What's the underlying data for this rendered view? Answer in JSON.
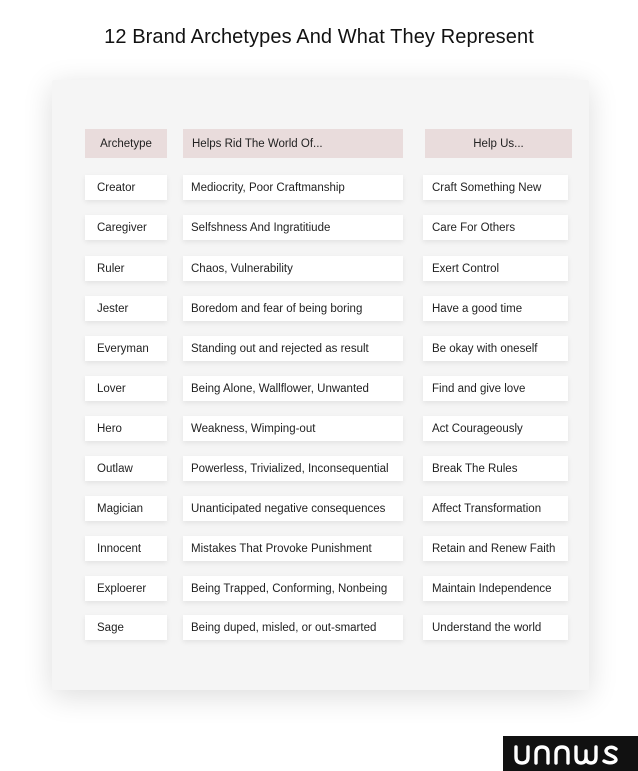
{
  "title": "12 Brand Archetypes And What They Represent",
  "headers": {
    "archetype": "Archetype",
    "rid": "Helps Rid The World Of...",
    "help": "Help Us..."
  },
  "rows": [
    {
      "archetype": "Creator",
      "rid": "Mediocrity, Poor Craftmanship",
      "help": "Craft Something New"
    },
    {
      "archetype": "Caregiver",
      "rid": "Selfshness And Ingratitiude",
      "help": "Care For Others"
    },
    {
      "archetype": "Ruler",
      "rid": "Chaos, Vulnerability",
      "help": "Exert Control"
    },
    {
      "archetype": "Jester",
      "rid": "Boredom and fear of being boring",
      "help": "Have a good time"
    },
    {
      "archetype": "Everyman",
      "rid": "Standing out and rejected as result",
      "help": "Be okay with oneself"
    },
    {
      "archetype": "Lover",
      "rid": "Being Alone, Wallflower, Unwanted",
      "help": "Find and give love"
    },
    {
      "archetype": "Hero",
      "rid": "Weakness, Wimping-out",
      "help": "Act Courageously"
    },
    {
      "archetype": "Outlaw",
      "rid": "Powerless, Trivialized, Inconsequential",
      "help": "Break The Rules"
    },
    {
      "archetype": "Magician",
      "rid": "Unanticipated negative consequences",
      "help": "Affect Transformation"
    },
    {
      "archetype": "Innocent",
      "rid": "Mistakes That Provoke Punishment",
      "help": "Retain and Renew Faith"
    },
    {
      "archetype": "Exploerer",
      "rid": "Being Trapped, Conforming, Nonbeing",
      "help": "Maintain Independence"
    },
    {
      "archetype": "Sage",
      "rid": "Being duped, misled, or out-smarted",
      "help": "Understand the world"
    }
  ],
  "logo": {
    "text": "unnus",
    "icon": "unnus-logo"
  },
  "colors": {
    "header_bg": "#e9dcdc",
    "card_bg": "#f5f5f5",
    "logo_bg": "#111111"
  }
}
